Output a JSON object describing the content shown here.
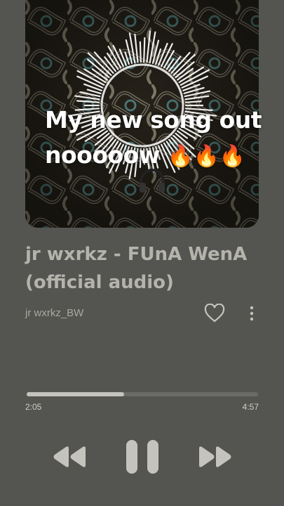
{
  "artwork": {
    "overlay_line1": "My new song out",
    "overlay_line2": "nooooow",
    "overlay_emoji": "🔥🔥🔥",
    "icon": "headphones-icon"
  },
  "track": {
    "title": "jr wxrkz - FUnA WenA (official audio)",
    "artist": "jr wxrkz_BW"
  },
  "progress": {
    "elapsed": "2:05",
    "total": "4:57",
    "fraction": 0.42
  },
  "controls": {
    "previous_icon": "previous-icon",
    "pause_icon": "pause-icon",
    "next_icon": "next-icon",
    "like_icon": "heart-icon",
    "more_icon": "more-vertical-icon"
  },
  "colors": {
    "background": "#545550",
    "controls": "#c4c3bd"
  }
}
